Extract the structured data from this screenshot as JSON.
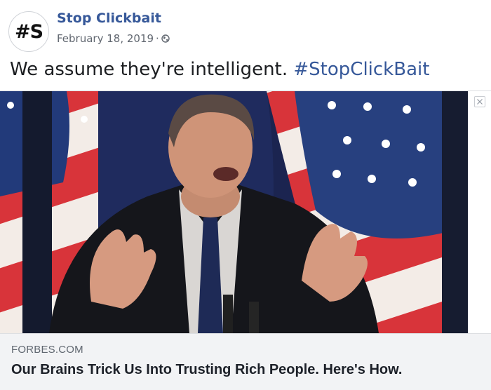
{
  "post": {
    "avatar_text": "#S",
    "page_name": "Stop Clickbait",
    "date": "February 18, 2019",
    "separator": "·",
    "audience_icon": "globe-icon",
    "text": "We assume they're intelligent.",
    "hashtag": "#StopClickBait"
  },
  "link_card": {
    "image_icon": "photo-of-speaker-at-podium-with-flags",
    "close_icon": "close-icon",
    "domain": "FORBES.COM",
    "headline": "Our Brains Trick Us Into Trusting Rich People. Here's How."
  },
  "colors": {
    "link_blue": "#365899",
    "text": "#1c1e21",
    "meta_gray": "#616770",
    "caption_bg": "#f2f3f5"
  }
}
